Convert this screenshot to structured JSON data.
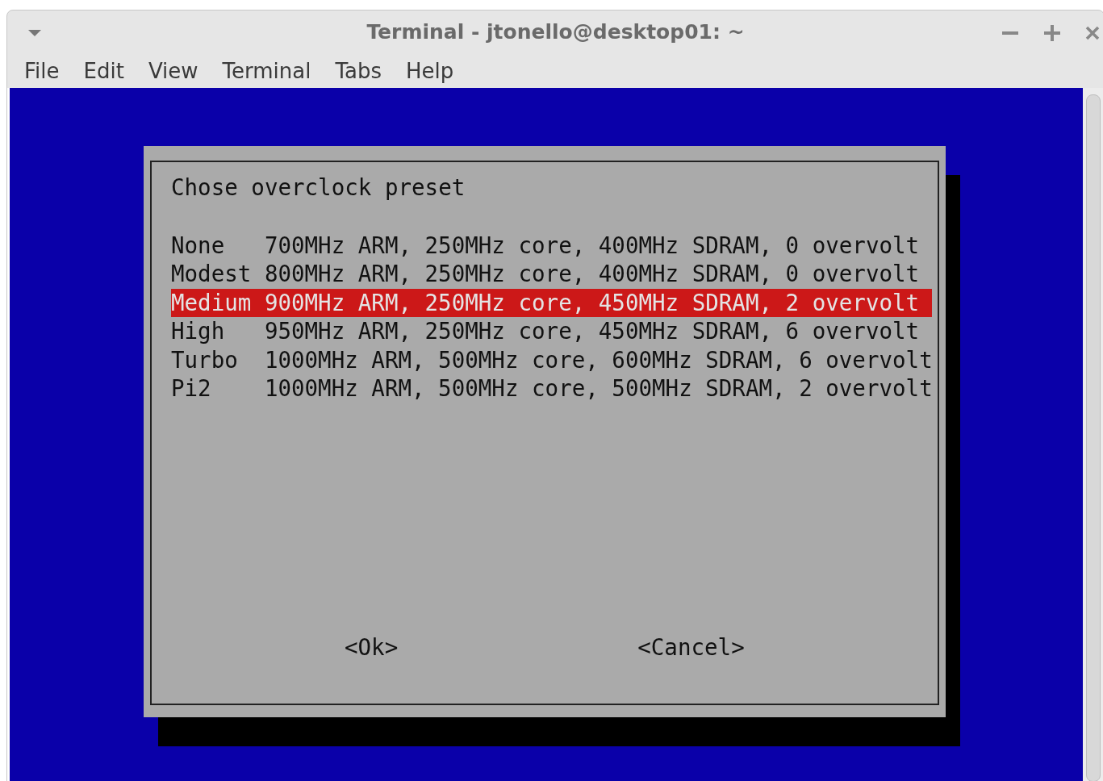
{
  "window": {
    "title": "Terminal - jtonello@desktop01: ~"
  },
  "menu": [
    "File",
    "Edit",
    "View",
    "Terminal",
    "Tabs",
    "Help"
  ],
  "dialog": {
    "title": "Chose overclock preset",
    "items": [
      {
        "name": "None",
        "spec": "700MHz ARM, 250MHz core, 400MHz SDRAM, 0 overvolt",
        "selected": false
      },
      {
        "name": "Modest",
        "spec": "800MHz ARM, 250MHz core, 400MHz SDRAM, 0 overvolt",
        "selected": false
      },
      {
        "name": "Medium",
        "spec": "900MHz ARM, 250MHz core, 450MHz SDRAM, 2 overvolt",
        "selected": true
      },
      {
        "name": "High",
        "spec": "950MHz ARM, 250MHz core, 450MHz SDRAM, 6 overvolt",
        "selected": false
      },
      {
        "name": "Turbo",
        "spec": "1000MHz ARM, 500MHz core, 600MHz SDRAM, 6 overvolt",
        "selected": false
      },
      {
        "name": "Pi2",
        "spec": "1000MHz ARM, 500MHz core, 500MHz SDRAM, 2 overvolt",
        "selected": false
      }
    ],
    "buttons": [
      "<Ok>",
      "<Cancel>"
    ]
  }
}
